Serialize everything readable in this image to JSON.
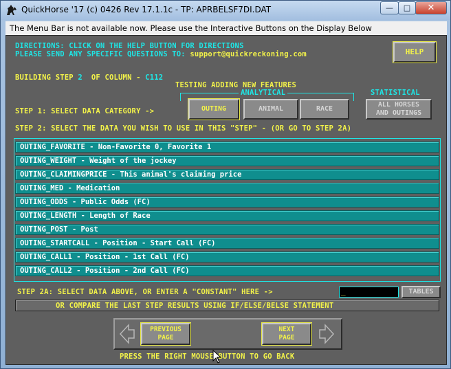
{
  "window": {
    "title": "QuickHorse '17 (c) 0426 Rev 17.1.1c - TP: APRBELSF7DI.DAT",
    "minimize": "—",
    "maximize": "□",
    "close": "✕"
  },
  "menubar": {
    "notice": "The Menu Bar is not available now.  Please use the Interactive Buttons on the Display Below"
  },
  "header": {
    "directions_line1": "DIRECTIONS:  CLICK ON THE HELP BUTTON FOR DIRECTIONS",
    "directions_line2_prefix": "PLEASE SEND ANY SPECIFIC QUESTIONS TO: ",
    "email": "support@quickreckoning.com",
    "help_label": "HELP"
  },
  "building": {
    "prefix": "BUILDING STEP",
    "step_number": "2",
    "of_column": "OF COLUMN -",
    "column": "C112",
    "note": "TESTING ADDING NEW FEATURES"
  },
  "categories": {
    "analytical_label": "ANALYTICAL",
    "statistical_label": "STATISTICAL",
    "step1_label": "STEP 1: SELECT DATA CATEGORY ->",
    "buttons": {
      "outing": "OUTING",
      "animal": "ANIMAL",
      "race": "RACE",
      "all_line1": "ALL HORSES",
      "all_line2": "AND OUTINGS"
    }
  },
  "step2": {
    "label": "STEP 2: SELECT THE DATA YOU WISH TO USE IN THIS \"STEP\" - (OR GO TO STEP 2A)",
    "items": [
      "OUTING_FAVORITE - Non-Favorite 0, Favorite 1",
      "OUTING_WEIGHT - Weight of the jockey",
      "OUTING_CLAIMINGPRICE - This animal's claiming price",
      "OUTING_MED - Medication",
      "OUTING_ODDS - Public Odds (FC)",
      "OUTING_LENGTH - Length of Race",
      "OUTING_POST - Post",
      "OUTING_STARTCALL - Position - Start Call (FC)",
      "OUTING_CALL1 - Position - 1st Call (FC)",
      "OUTING_CALL2 - Position - 2nd Call (FC)"
    ]
  },
  "step2a": {
    "label": "STEP 2A:  SELECT DATA ABOVE, OR ENTER A \"CONSTANT\" HERE ->",
    "constant_value": "_",
    "tables_label": "TABLES"
  },
  "compare": {
    "label": "OR COMPARE THE LAST STEP RESULTS USING IF/ELSE/BELSE STATEMENT"
  },
  "navigation": {
    "previous_line1": "PREVIOUS",
    "previous_line2": "PAGE",
    "next_line1": "NEXT",
    "next_line2": "PAGE",
    "footer": "PRESS THE RIGHT MOUSE BUTTON TO GO BACK"
  },
  "colors": {
    "cyan": "#1ee6e6",
    "yellow": "#f2f24a",
    "field_teal": "#0f8e8e",
    "panel_gray": "#5f5f5f"
  }
}
